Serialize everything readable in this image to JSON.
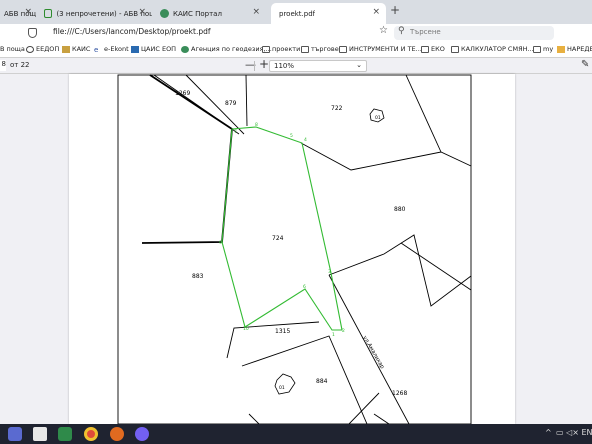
{
  "tabs": [
    {
      "label": "АБВ поща",
      "close": "×",
      "active": false
    },
    {
      "label": "(3 непрочетени) - АБВ поща",
      "close": "×",
      "active": false
    },
    {
      "label": "КАИС Портал",
      "close": "×",
      "active": false
    },
    {
      "label": "proekt.pdf",
      "close": "×",
      "active": true
    }
  ],
  "new_tab": "+",
  "address_bar": {
    "url": "file:///C:/Users/lancom/Desktop/proekt.pdf",
    "star": "☆",
    "search_placeholder": "Търсене",
    "search_icon": "⚲"
  },
  "bookmarks": [
    {
      "label": "В поща",
      "icon": "mail"
    },
    {
      "label": "ЕЕДОП",
      "icon": "globe"
    },
    {
      "label": "КАИС",
      "icon": "kais"
    },
    {
      "label": "e-Ekont",
      "icon": "ekont"
    },
    {
      "label": "ЦАИС ЕОП",
      "icon": "eop"
    },
    {
      "label": "Агенция по геодезия,...",
      "icon": "geo"
    },
    {
      "label": "проекти",
      "icon": "folder"
    },
    {
      "label": "търгове",
      "icon": "folder"
    },
    {
      "label": "ИНСТРУМЕНТИ И ТЕ...",
      "icon": "folder"
    },
    {
      "label": "ЕКО",
      "icon": "folder"
    },
    {
      "label": "КАЛКУЛАТОР СМЯН...",
      "icon": "folder"
    },
    {
      "label": "my",
      "icon": "folder"
    },
    {
      "label": "НАРЕДБ...",
      "icon": "folder"
    }
  ],
  "pdf_toolbar": {
    "page_number": "8",
    "page_of": "от 22",
    "zoom_out": "—",
    "zoom_in": "+",
    "zoom": "110%",
    "zoom_chevron": "⌄",
    "pencil": "✎"
  },
  "map": {
    "parcel_labels": [
      "1269",
      "879",
      "722",
      "01",
      "880",
      "724",
      "883",
      "1315",
      "884",
      "01",
      "1268"
    ],
    "street": "ул.Амалихар",
    "vertex_labels": [
      "7",
      "8",
      "5",
      "4",
      "3",
      "2",
      "1",
      "6",
      "9",
      "10"
    ],
    "colors": {
      "boundary": "#000000",
      "highlight": "#33bb33"
    }
  },
  "taskbar": {
    "tray_arrow": "^",
    "tray_icons": "▭ ◁× ENG"
  }
}
